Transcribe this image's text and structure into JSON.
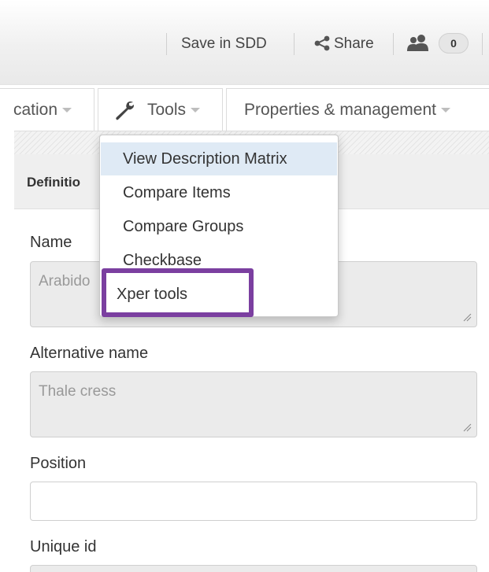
{
  "topbar": {
    "save_sdd": "Save in SDD",
    "share": "Share",
    "users_count": "0"
  },
  "tabs": {
    "classification_partial": "cation",
    "tools": "Tools",
    "properties": "Properties & management"
  },
  "panel": {
    "title_partial": "Definitio"
  },
  "form": {
    "name_label": "Name",
    "name_value_partial": "Arabido",
    "alt_name_label": "Alternative name",
    "alt_name_value": "Thale cress",
    "position_label": "Position",
    "position_value": "",
    "unique_id_label": "Unique id"
  },
  "tools_menu": {
    "items": [
      "View Description Matrix",
      "Compare Items",
      "Compare Groups",
      "Checkbase",
      "Xper tools"
    ],
    "highlight_color": "#7b3fa0"
  }
}
